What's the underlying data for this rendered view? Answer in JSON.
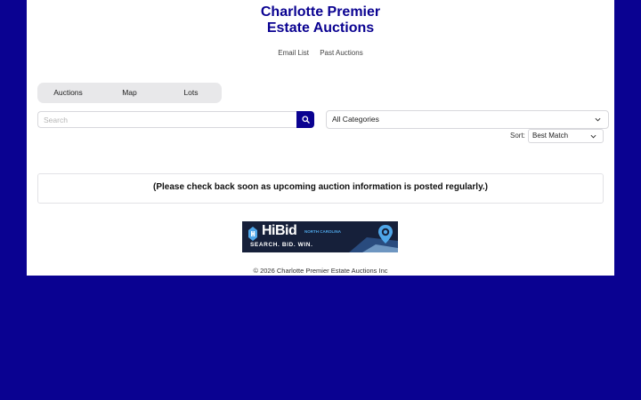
{
  "header": {
    "title_line1": "Charlotte Premier",
    "title_line2": "Estate Auctions",
    "links": [
      "Email List",
      "Past Auctions"
    ]
  },
  "tabs": [
    {
      "label": "Auctions"
    },
    {
      "label": "Map"
    },
    {
      "label": "Lots"
    }
  ],
  "search": {
    "placeholder": "Search",
    "value": ""
  },
  "category": {
    "selected": "All Categories"
  },
  "sort": {
    "label": "Sort:",
    "selected": "Best Match"
  },
  "notice": {
    "text": "(Please check back soon as upcoming auction information is posted regularly.)"
  },
  "banner": {
    "brand": "HiBid",
    "region": "NORTH CAROLINA",
    "tagline": "SEARCH. BID. WIN."
  },
  "footer": {
    "copyright": "© 2026 Charlotte Premier Estate Auctions Inc"
  },
  "colors": {
    "brand": "#0a0291",
    "background": "#0a0291",
    "panel": "#ffffff",
    "banner_bg": "#16203a",
    "banner_accent": "#4fa6e8"
  }
}
